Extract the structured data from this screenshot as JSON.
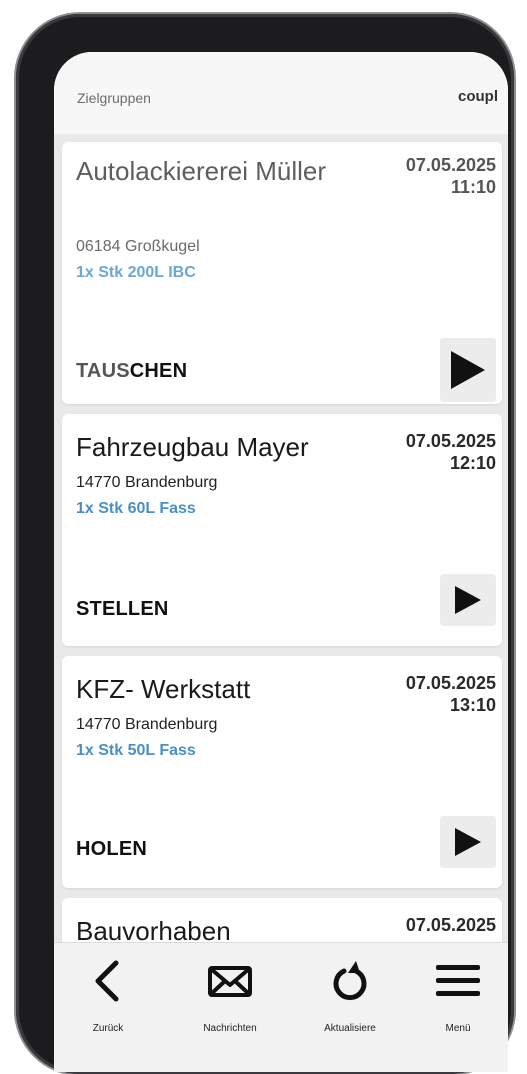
{
  "header": {
    "left_label": "Zielgruppen",
    "right_label": "coupl"
  },
  "cards": [
    {
      "company": "Autolackiererei Müller",
      "address": "06184 Großkugel",
      "item": "1x Stk 200L IBC",
      "date": "07.05.2025",
      "time": "11:10",
      "action_prefix": "TAUS",
      "action_suffix": "CHEN",
      "action": "TAUSCHEN"
    },
    {
      "company": "Fahrzeugbau Mayer",
      "address": "14770 Brandenburg",
      "item": "1x Stk 60L Fass",
      "date": "07.05.2025",
      "time": "12:10",
      "action": "STELLEN"
    },
    {
      "company": "KFZ- Werkstatt",
      "address": "14770 Brandenburg",
      "item": "1x Stk 50L Fass",
      "date": "07.05.2025",
      "time": "13:10",
      "action": "HOLEN"
    },
    {
      "company": "Bauvorhaben",
      "date": "07.05.2025"
    }
  ],
  "nav": [
    {
      "label": "Zurück",
      "icon": "back-arrow-icon"
    },
    {
      "label": "Nachrichten",
      "icon": "envelope-icon"
    },
    {
      "label": "Aktualisiere",
      "icon": "refresh-icon"
    },
    {
      "label": "Menü",
      "icon": "hamburger-menu-icon"
    }
  ]
}
